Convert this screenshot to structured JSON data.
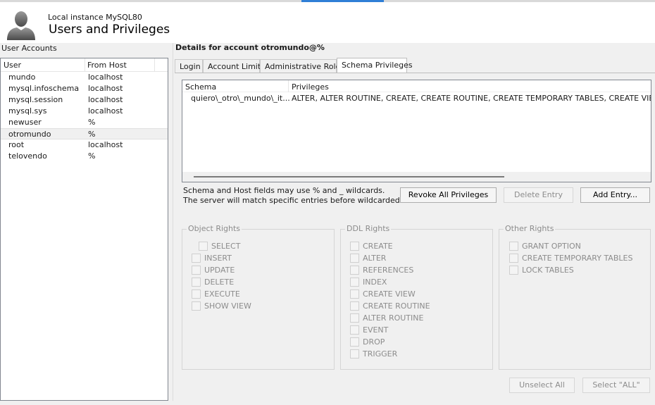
{
  "header": {
    "instance": "Local instance MySQL80",
    "title": "Users and Privileges"
  },
  "accounts": {
    "label": "User Accounts",
    "columns": [
      "User",
      "From Host"
    ],
    "rows": [
      {
        "user": "mundo",
        "host": "localhost"
      },
      {
        "user": "mysql.infoschema",
        "host": "localhost"
      },
      {
        "user": "mysql.session",
        "host": "localhost"
      },
      {
        "user": "mysql.sys",
        "host": "localhost"
      },
      {
        "user": "newuser",
        "host": "%"
      },
      {
        "user": "otromundo",
        "host": "%"
      },
      {
        "user": "root",
        "host": "localhost"
      },
      {
        "user": "telovendo",
        "host": "%"
      }
    ],
    "selected_index": 5
  },
  "details": {
    "title": "Details for account otromundo@%",
    "tabs": [
      "Login",
      "Account Limits",
      "Administrative Roles",
      "Schema Privileges"
    ],
    "active_tab": 3
  },
  "schema": {
    "columns": [
      "Schema",
      "Privileges"
    ],
    "rows": [
      {
        "schema": "quiero\\_otro\\_mundo\\_it...",
        "privileges": "ALTER, ALTER ROUTINE, CREATE, CREATE ROUTINE, CREATE TEMPORARY TABLES, CREATE VIEW,"
      }
    ],
    "hint_line1": "Schema and Host fields may use % and _ wildcards.",
    "hint_line2": "The server will match specific entries before wildcarded ones.",
    "revoke_label": "Revoke All Privileges",
    "delete_label": "Delete Entry",
    "add_label": "Add Entry..."
  },
  "rights": {
    "object": {
      "legend": "Object Rights",
      "items": [
        "SELECT",
        "INSERT",
        "UPDATE",
        "DELETE",
        "EXECUTE",
        "SHOW VIEW"
      ]
    },
    "ddl": {
      "legend": "DDL Rights",
      "items": [
        "CREATE",
        "ALTER",
        "REFERENCES",
        "INDEX",
        "CREATE VIEW",
        "CREATE ROUTINE",
        "ALTER ROUTINE",
        "EVENT",
        "DROP",
        "TRIGGER"
      ]
    },
    "other": {
      "legend": "Other Rights",
      "items": [
        "GRANT OPTION",
        "CREATE TEMPORARY TABLES",
        "LOCK TABLES"
      ]
    }
  },
  "footer": {
    "unselect_label": "Unselect All",
    "select_all_label": "Select \"ALL\""
  },
  "colors": {
    "accent": "#2f7fd6",
    "disabled_text": "#8c8c8c"
  }
}
